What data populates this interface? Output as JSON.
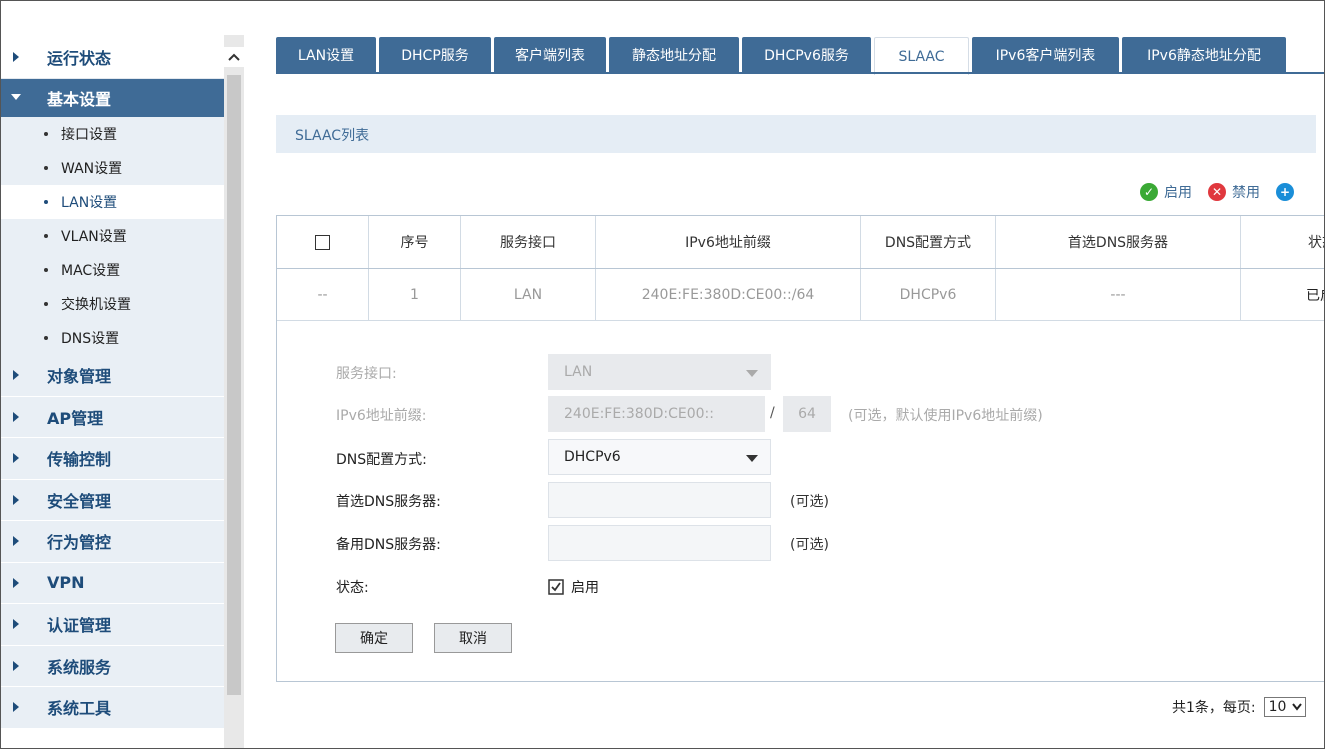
{
  "sidebar": {
    "top_item": {
      "label": "运行状态"
    },
    "active_group": {
      "label": "基本设置"
    },
    "sub_items": [
      {
        "label": "接口设置"
      },
      {
        "label": "WAN设置"
      },
      {
        "label": "LAN设置"
      },
      {
        "label": "VLAN设置"
      },
      {
        "label": "MAC设置"
      },
      {
        "label": "交换机设置"
      },
      {
        "label": "DNS设置"
      }
    ],
    "groups": [
      {
        "label": "对象管理"
      },
      {
        "label": "AP管理"
      },
      {
        "label": "传输控制"
      },
      {
        "label": "安全管理"
      },
      {
        "label": "行为管控"
      },
      {
        "label": "VPN"
      },
      {
        "label": "认证管理"
      },
      {
        "label": "系统服务"
      },
      {
        "label": "系统工具"
      }
    ]
  },
  "tabs": [
    {
      "label": "LAN设置"
    },
    {
      "label": "DHCP服务"
    },
    {
      "label": "客户端列表"
    },
    {
      "label": "静态地址分配"
    },
    {
      "label": "DHCPv6服务"
    },
    {
      "label": "SLAAC"
    },
    {
      "label": "IPv6客户端列表"
    },
    {
      "label": "IPv6静态地址分配"
    }
  ],
  "section": {
    "title": "SLAAC列表"
  },
  "toolbar": {
    "enable_label": "启用",
    "disable_label": "禁用"
  },
  "table": {
    "headers": [
      "序号",
      "服务接口",
      "IPv6地址前缀",
      "DNS配置方式",
      "首选DNS服务器",
      "状态"
    ],
    "row": {
      "check": "--",
      "index": "1",
      "interface": "LAN",
      "prefix": "240E:FE:380D:CE00::/64",
      "dns_mode": "DHCPv6",
      "preferred_dns": "---",
      "status": "已启"
    }
  },
  "form": {
    "interface_label": "服务接口:",
    "interface_value": "LAN",
    "prefix_label": "IPv6地址前缀:",
    "prefix_value": "240E:FE:380D:CE00::",
    "prefix_sep": "/",
    "prefix_len": "64",
    "prefix_hint": "(可选，默认使用IPv6地址前缀)",
    "dns_mode_label": "DNS配置方式:",
    "dns_mode_value": "DHCPv6",
    "preferred_dns_label": "首选DNS服务器:",
    "preferred_dns_hint": "(可选)",
    "backup_dns_label": "备用DNS服务器:",
    "backup_dns_hint": "(可选)",
    "status_label": "状态:",
    "status_checkbox_label": "启用",
    "ok_label": "确定",
    "cancel_label": "取消"
  },
  "pager": {
    "summary": "共1条，每页:",
    "page_size": "10"
  },
  "colors": {
    "accent": "#3f6b96",
    "sidebar_bg": "#e9eff5",
    "enable": "#3aa935",
    "disable": "#e0383e",
    "add": "#1a8ed8"
  }
}
